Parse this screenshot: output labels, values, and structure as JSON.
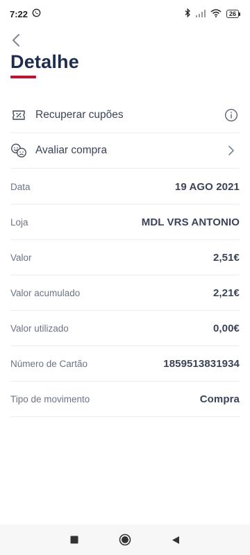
{
  "status_bar": {
    "time": "7:22",
    "battery": "26"
  },
  "header": {
    "title": "Detalhe",
    "accent_color": "#c8102e",
    "title_color": "#1f2c4d"
  },
  "actions": [
    {
      "label": "Recuperar cupões",
      "icon": "coupon-icon",
      "trailing": "info-icon"
    },
    {
      "label": "Avaliar compra",
      "icon": "smiley-faces-icon",
      "trailing": "chevron-right-icon"
    }
  ],
  "details": [
    {
      "label": "Data",
      "value": "19 AGO 2021"
    },
    {
      "label": "Loja",
      "value": "MDL VRS ANTONIO"
    },
    {
      "label": "Valor",
      "value": "2,51€"
    },
    {
      "label": "Valor acumulado",
      "value": "2,21€"
    },
    {
      "label": "Valor utilizado",
      "value": "0,00€"
    },
    {
      "label": "Número de Cartão",
      "value": "1859513831934"
    },
    {
      "label": "Tipo de movimento",
      "value": "Compra"
    }
  ]
}
